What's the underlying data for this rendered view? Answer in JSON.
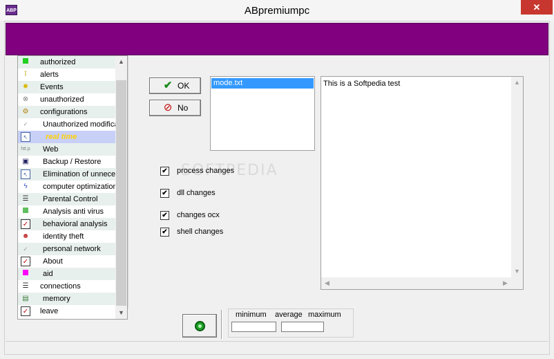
{
  "window": {
    "icon_text": "ABP",
    "title": "ABpremiumpc",
    "close": "✕"
  },
  "sidebar": {
    "items": [
      {
        "label": "authorized",
        "icon": "green-square-icon"
      },
      {
        "label": "alerts",
        "icon": "alert-figure-icon"
      },
      {
        "label": "Events",
        "icon": "lightbulb-icon"
      },
      {
        "label": "unauthorized",
        "icon": "block-icon"
      },
      {
        "label": "configurations",
        "icon": "config-gear-icon"
      },
      {
        "label": "Unauthorized modifications",
        "icon": "small-check-icon"
      },
      {
        "label": "real time",
        "icon": "cursor-icon"
      },
      {
        "label": "Web",
        "icon": "web-icon"
      },
      {
        "label": "Backup / Restore",
        "icon": "floppy-icon"
      },
      {
        "label": "Elimination of unnecessary files",
        "icon": "cursor-icon"
      },
      {
        "label": "computer optimization",
        "icon": "lightning-icon"
      },
      {
        "label": "Parental Control",
        "icon": "document-icon"
      },
      {
        "label": "Analysis anti virus",
        "icon": "green-square-icon"
      },
      {
        "label": "behavioral analysis",
        "icon": "check-icon"
      },
      {
        "label": "identity theft",
        "icon": "people-icon"
      },
      {
        "label": "personal network",
        "icon": "small-check-icon"
      },
      {
        "label": "About",
        "icon": "check-icon"
      },
      {
        "label": "aid",
        "icon": "magenta-square-icon"
      },
      {
        "label": "connections",
        "icon": "document-icon"
      },
      {
        "label": "memory",
        "icon": "memory-icon"
      },
      {
        "label": "leave",
        "icon": "check-icon"
      }
    ]
  },
  "buttons": {
    "ok": "OK",
    "no": "No"
  },
  "file_list": {
    "selected": "mode.txt"
  },
  "text_area": {
    "content": "This is a Softpedia test"
  },
  "checkboxes": [
    {
      "label": "process changes",
      "checked": true
    },
    {
      "label": "dll changes",
      "checked": true
    },
    {
      "label": "changes ocx",
      "checked": true
    },
    {
      "label": "shell changes",
      "checked": true
    }
  ],
  "stats": {
    "minimum": "minimum",
    "average": "average",
    "maximum": "maximum"
  },
  "watermark": "SOFTPEDIA",
  "colors": {
    "header": "#800080",
    "selection": "#3399ff",
    "close": "#c7372f"
  }
}
